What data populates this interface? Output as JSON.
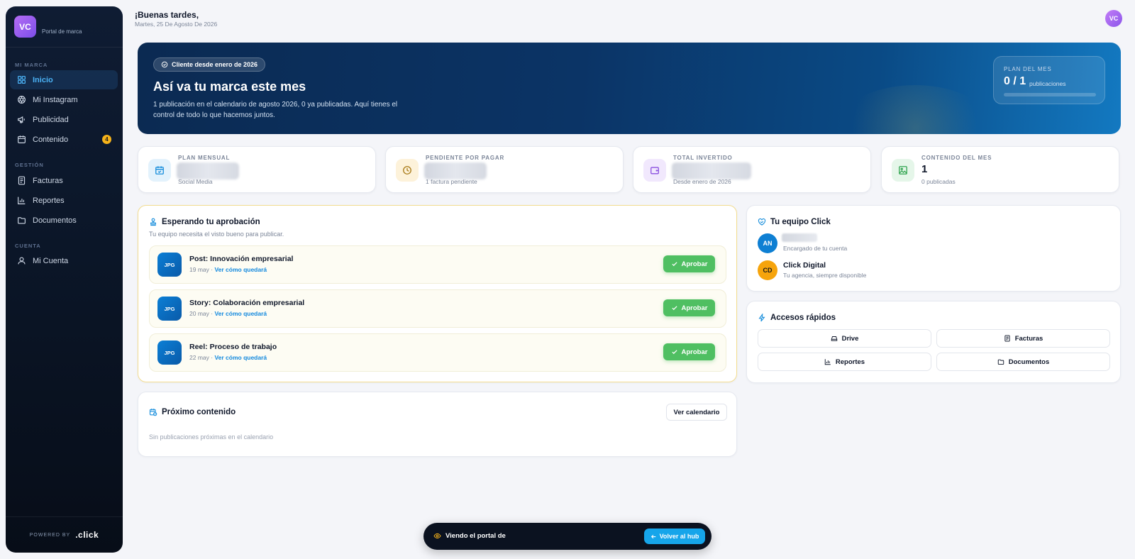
{
  "sidebar": {
    "avatar": "VC",
    "subtitle": "Portal de marca",
    "sections": [
      "MI MARCA",
      "GESTIÓN",
      "CUENTA"
    ],
    "items": [
      {
        "label": "Inicio",
        "icon": "grid-icon"
      },
      {
        "label": "Mi Instagram",
        "icon": "instagram-icon"
      },
      {
        "label": "Publicidad",
        "icon": "megaphone-icon"
      },
      {
        "label": "Contenido",
        "icon": "calendar-icon",
        "badge": "4"
      },
      {
        "label": "Facturas",
        "icon": "invoice-icon"
      },
      {
        "label": "Reportes",
        "icon": "bar-chart-icon"
      },
      {
        "label": "Documentos",
        "icon": "folder-icon"
      },
      {
        "label": "Mi Cuenta",
        "icon": "user-icon"
      }
    ],
    "powered_by": "POWERED BY",
    "logo": ".click"
  },
  "header": {
    "greeting": "¡Buenas tardes,",
    "date": "Martes, 25 De Agosto De 2026",
    "avatar": "VC"
  },
  "hero": {
    "pill": "Cliente desde enero de 2026",
    "title": "Así va tu marca este mes",
    "description": "1 publicación en el calendario de agosto 2026, 0 ya publicadas. Aquí tienes el control de todo lo que hacemos juntos.",
    "plan_label": "PLAN DEL MES",
    "plan_value": "0 / 1",
    "plan_unit": "publicaciones",
    "plan_progress": 0
  },
  "stats": [
    {
      "label": "PLAN MENSUAL",
      "sub": "Social Media",
      "icon": "calendar-check-icon"
    },
    {
      "label": "PENDIENTE POR PAGAR",
      "sub": "1 factura pendiente",
      "icon": "clock-icon"
    },
    {
      "label": "TOTAL INVERTIDO",
      "sub": "Desde enero de 2026",
      "icon": "wallet-icon"
    },
    {
      "label": "CONTENIDO DEL MES",
      "value": "1",
      "sub": "0 publicadas",
      "icon": "image-icon"
    }
  ],
  "approval": {
    "title": "Esperando tu aprobación",
    "subtitle": "Tu equipo necesita el visto bueno para publicar.",
    "items": [
      {
        "thumb": "JPG",
        "title": "Post: Innovación empresarial",
        "date": "19 may",
        "link": "Ver cómo quedará",
        "action": "Aprobar"
      },
      {
        "thumb": "JPG",
        "title": "Story: Colaboración empresarial",
        "date": "20 may",
        "link": "Ver cómo quedará",
        "action": "Aprobar"
      },
      {
        "thumb": "JPG",
        "title": "Reel: Proceso de trabajo",
        "date": "22 may",
        "link": "Ver cómo quedará",
        "action": "Aprobar"
      }
    ]
  },
  "next_content": {
    "title": "Próximo contenido",
    "button": "Ver calendario",
    "empty": "Sin publicaciones próximas en el calendario"
  },
  "team": {
    "title": "Tu equipo Click",
    "members": [
      {
        "initials": "AN",
        "name": "",
        "role": "Encargado de tu cuenta",
        "color": "#0e7fd3"
      },
      {
        "initials": "CD",
        "name": "Click Digital",
        "role": "Tu agencia, siempre disponible",
        "color": "#f6a40c"
      }
    ]
  },
  "quick_access": {
    "title": "Accesos rápidos",
    "items": [
      {
        "label": "Drive",
        "icon": "drive-icon"
      },
      {
        "label": "Facturas",
        "icon": "invoice-icon"
      },
      {
        "label": "Reportes",
        "icon": "bar-chart-icon"
      },
      {
        "label": "Documentos",
        "icon": "folder-icon"
      }
    ]
  },
  "viewbar": {
    "text": "Viendo el portal de",
    "button": "Volver al hub"
  }
}
